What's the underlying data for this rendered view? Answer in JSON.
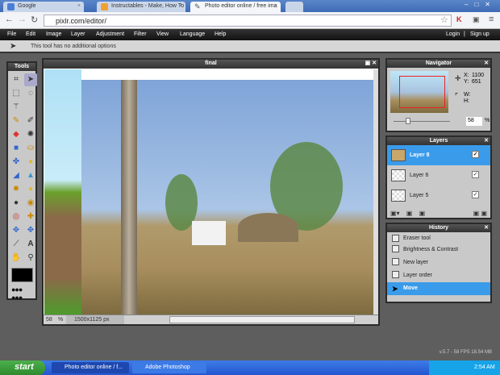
{
  "browser": {
    "tabs": [
      {
        "label": "Google"
      },
      {
        "label": "Instructables - Make, How To"
      },
      {
        "label": "Photo editor online / free ima"
      }
    ],
    "url": "pixlr.com/editor/"
  },
  "menu": {
    "items": [
      "File",
      "Edit",
      "Image",
      "Layer",
      "Adjustment",
      "Filter",
      "View",
      "Language",
      "Help"
    ],
    "login": "Login",
    "separator": "|",
    "signup": "Sign up"
  },
  "options": {
    "text": "This tool has no additional options"
  },
  "tools": {
    "title": "Tools"
  },
  "canvas": {
    "title": "final",
    "zoom": "58",
    "zoom_unit": "%",
    "size": "1500x1125 px"
  },
  "navigator": {
    "title": "Navigator",
    "x_label": "X:",
    "x": "1100",
    "y_label": "Y:",
    "y": "651",
    "w_label": "W:",
    "h_label": "H:",
    "zoom": "58",
    "zoom_unit": "%"
  },
  "layers": {
    "title": "Layers",
    "items": [
      {
        "name": "Layer 8",
        "selected": true
      },
      {
        "name": "Layer 6"
      },
      {
        "name": "Layer 5"
      }
    ]
  },
  "history": {
    "title": "History",
    "items": [
      {
        "name": "Eraser tool"
      },
      {
        "name": "Brightness & Contrast"
      },
      {
        "name": "New layer"
      },
      {
        "name": "Layer order"
      },
      {
        "name": "Move",
        "selected": true
      }
    ]
  },
  "footer": {
    "stats": "v.5.7 - 58 FPS 18.54 MB"
  },
  "taskbar": {
    "start": "start",
    "items": [
      "Photo editor online / f...",
      "Adobe Photoshop"
    ],
    "time": "2:54 AM"
  },
  "colors": {
    "accent": "#3a9bea",
    "workspace": "#5e5e5e"
  }
}
